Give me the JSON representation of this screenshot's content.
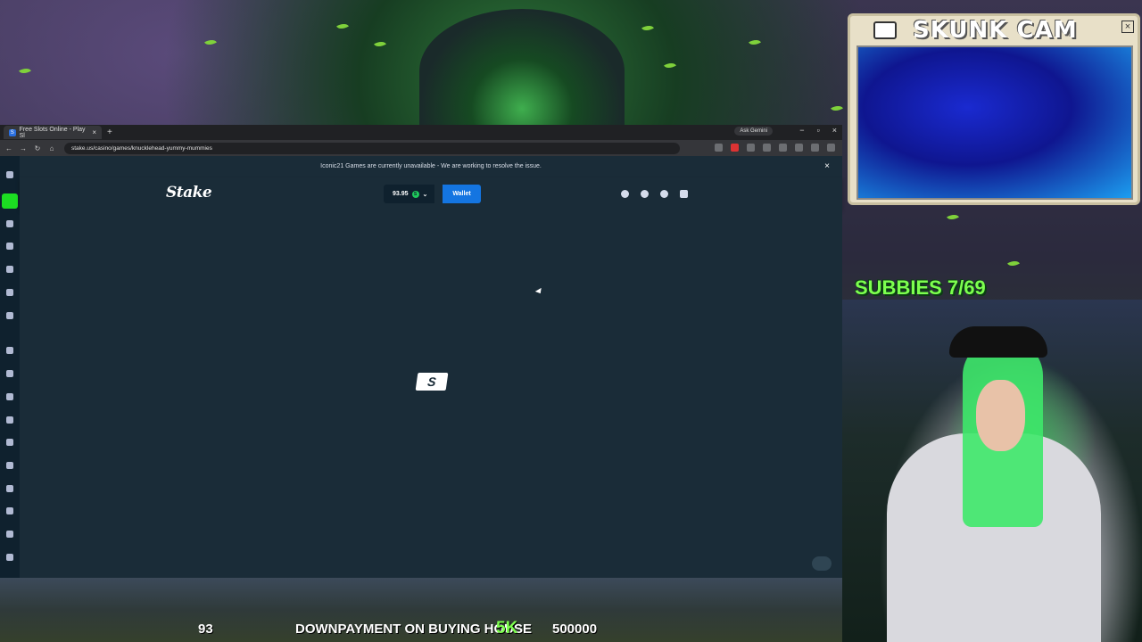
{
  "browser": {
    "tab_title": "Free Slots Online - Play Sl",
    "tab_close": "×",
    "new_tab": "+",
    "gemini_label": "Ask Gemini",
    "window_controls": [
      "−",
      "▫",
      "×"
    ],
    "url": "stake.us/casino/games/knucklehead-yummy-mummies"
  },
  "notice": {
    "text": "Iconic21 Games are currently unavailable - We are working to resolve the issue.",
    "close": "×"
  },
  "header": {
    "logo": "Stake",
    "balance": "93.95",
    "coin": "S",
    "wallet_label": "Wallet",
    "icons": [
      "search-icon",
      "user-icon",
      "bell-icon",
      "chat-icon"
    ]
  },
  "content": {
    "loader_text": "S"
  },
  "overlay": {
    "cam_title": "SKUNK CAM",
    "cam_close": "×",
    "subbies": "SUBBIES 7/69",
    "ticker_count": "93",
    "ticker_goal": "DOWNPAYMENT ON BUYING HOUSE",
    "ticker_highlight": "5K",
    "ticker_target": "500000"
  },
  "colors": {
    "stake_bg": "#1a2c38",
    "sidebar_bg": "#0f212e",
    "wallet_blue": "#1475e1",
    "accent_green": "#7dff4f"
  }
}
